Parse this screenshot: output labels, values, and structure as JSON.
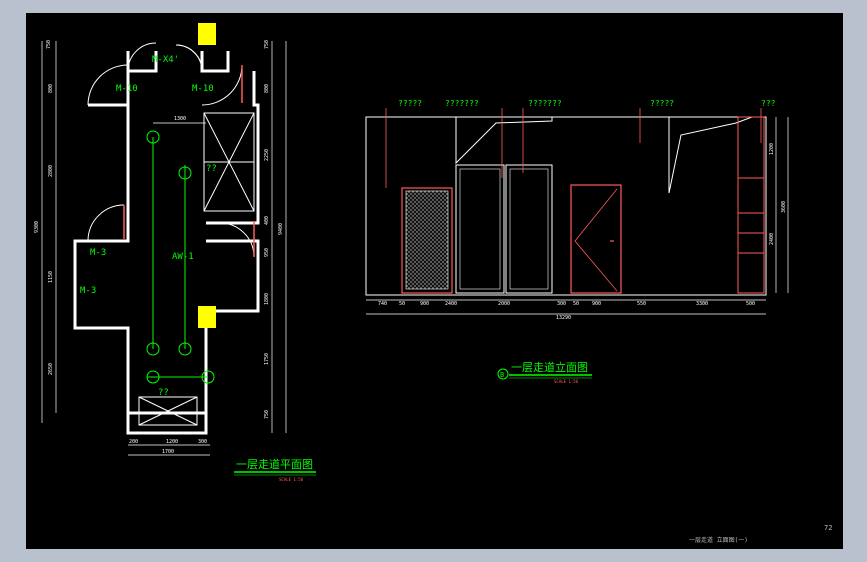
{
  "drawing": {
    "background": "#000000",
    "frame_color": "#b9c1cf",
    "colors": {
      "wall": "#ffffff",
      "text": "#ffffff",
      "label_green": "#00ff00",
      "dimension": "#ffffff",
      "door": "#ff5a5a",
      "highlight": "#ffff00",
      "grid": "#555555"
    }
  },
  "plan": {
    "title": "一层走道平面图",
    "scale_note": "SCALE 1:50",
    "door_labels": [
      "M-X4'",
      "M-10",
      "M-10",
      "M-3",
      "M-3"
    ],
    "axis_label": "AW-1",
    "unknown_labels": [
      "??",
      "??"
    ],
    "left_dimensions": [
      "750",
      "800",
      "2800",
      "1150",
      "2650",
      "9300"
    ],
    "right_dimensions": [
      "750",
      "800",
      "2250",
      "400",
      "950",
      "1800",
      "1750",
      "750",
      "9400"
    ],
    "top_dimension": "1300",
    "bottom_dimensions": [
      "200",
      "1200",
      "300",
      "1700"
    ]
  },
  "elevation": {
    "title": "一层走道立面图",
    "badge": "B",
    "scale_note": "SCALE 1:50",
    "callouts": [
      "?????",
      "???????",
      "???????",
      "?????",
      "???"
    ],
    "bottom_dimensions": [
      "740",
      "50",
      "900",
      "2400",
      "2000",
      "300",
      "50",
      "900",
      "550",
      "3300",
      "500"
    ],
    "total_dimension": "13290",
    "right_dimensions": [
      "1200",
      "2400",
      "3600"
    ]
  },
  "sheet": {
    "number": "72",
    "caption": "一层走道 立面图(一)"
  }
}
